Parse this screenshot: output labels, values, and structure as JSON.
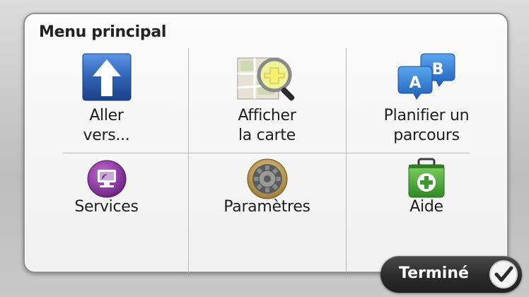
{
  "menu": {
    "title": "Menu principal",
    "items": [
      {
        "line1": "Aller",
        "line2": "vers...",
        "icon": "navigate-arrow-icon"
      },
      {
        "line1": "Afficher",
        "line2": "la carte",
        "icon": "map-magnifier-icon"
      },
      {
        "line1": "Planifier un",
        "line2": "parcours",
        "icon": "route-ab-icon"
      },
      {
        "line1": "Services",
        "icon": "services-monitor-icon"
      },
      {
        "line1": "Paramètres",
        "icon": "settings-gear-icon"
      },
      {
        "line1": "Aide",
        "icon": "help-firstaid-icon"
      }
    ]
  },
  "footer": {
    "done_label": "Terminé",
    "done_icon": "checkmark-icon"
  },
  "colors": {
    "nav_blue": "#2f63b5",
    "route_blue": "#2a79d3",
    "services_purple": "#7e2d92",
    "help_green": "#3a9a2e",
    "done_dark": "#2b2b2b"
  }
}
